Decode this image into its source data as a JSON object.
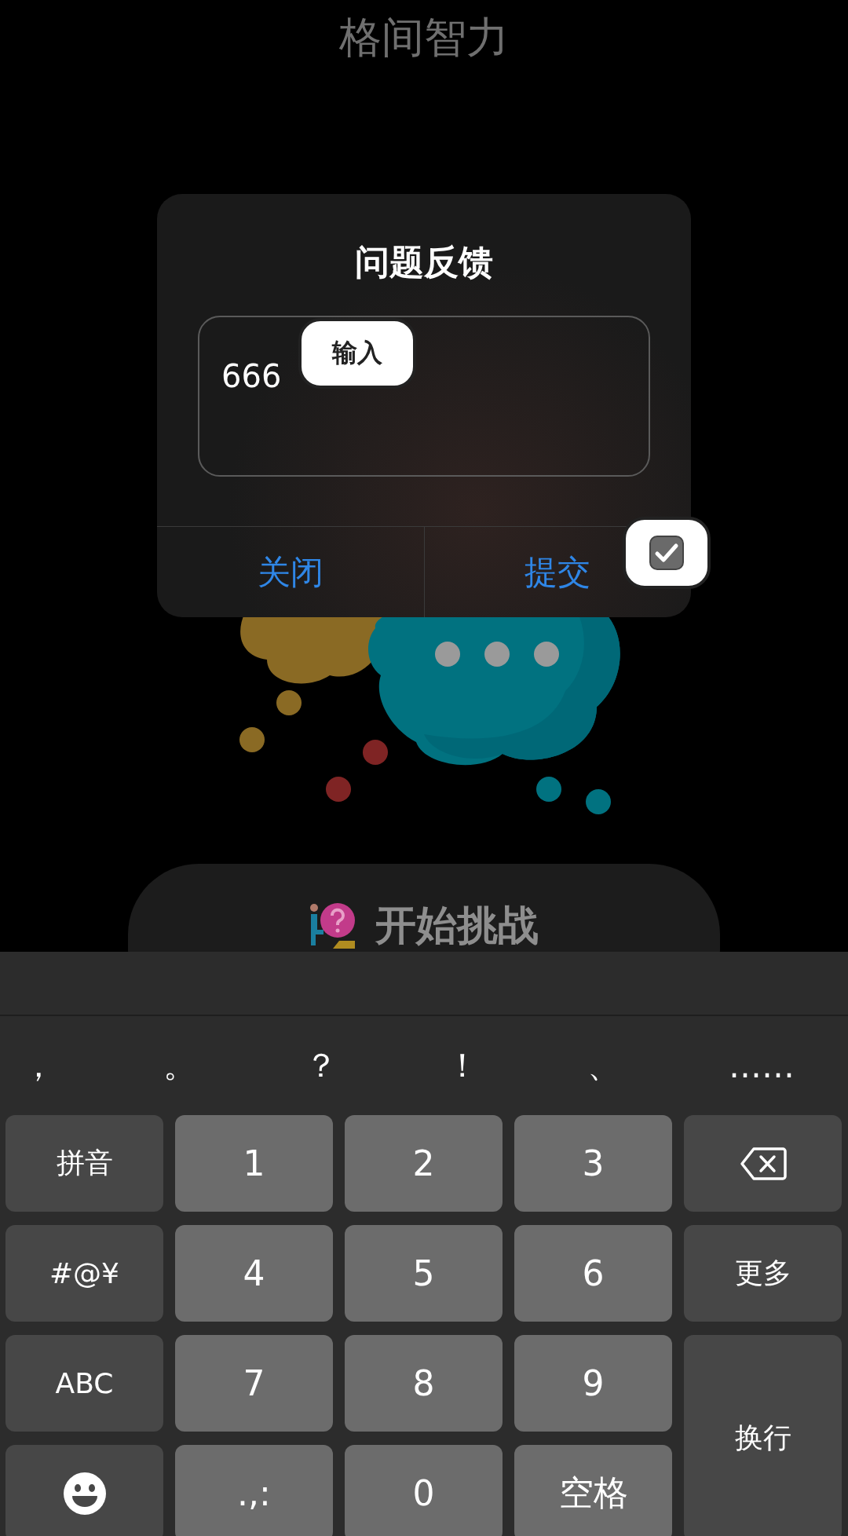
{
  "app_title": "格间智力",
  "dialog": {
    "title": "问题反馈",
    "field": {
      "value": "666"
    },
    "buttons": [
      {
        "label": "关闭"
      },
      {
        "label": "提交"
      }
    ]
  },
  "annotations": [
    {
      "kind": "label",
      "text": "输入"
    },
    {
      "kind": "checkbox",
      "checked": true
    }
  ],
  "start_button": {
    "label": "开始挑战"
  },
  "keyboard": {
    "punctuation": [
      "，",
      "。",
      "？",
      "！",
      "、",
      "……"
    ],
    "keys": [
      {
        "kind": "side",
        "label": "拼音"
      },
      {
        "kind": "digit",
        "label": "1"
      },
      {
        "kind": "digit",
        "label": "2"
      },
      {
        "kind": "digit",
        "label": "3"
      },
      {
        "kind": "backspace"
      },
      {
        "kind": "side",
        "label": "#@¥"
      },
      {
        "kind": "digit",
        "label": "4"
      },
      {
        "kind": "digit",
        "label": "5"
      },
      {
        "kind": "digit",
        "label": "6"
      },
      {
        "kind": "side",
        "label": "更多"
      },
      {
        "kind": "side",
        "label": "ABC"
      },
      {
        "kind": "digit",
        "label": "7"
      },
      {
        "kind": "digit",
        "label": "8"
      },
      {
        "kind": "digit",
        "label": "9"
      },
      {
        "kind": "enter",
        "label": "换行"
      },
      {
        "kind": "emoji"
      },
      {
        "kind": "digit",
        "label": ".,:"
      },
      {
        "kind": "digit",
        "label": "0"
      },
      {
        "kind": "digit",
        "label": "空格"
      }
    ]
  }
}
